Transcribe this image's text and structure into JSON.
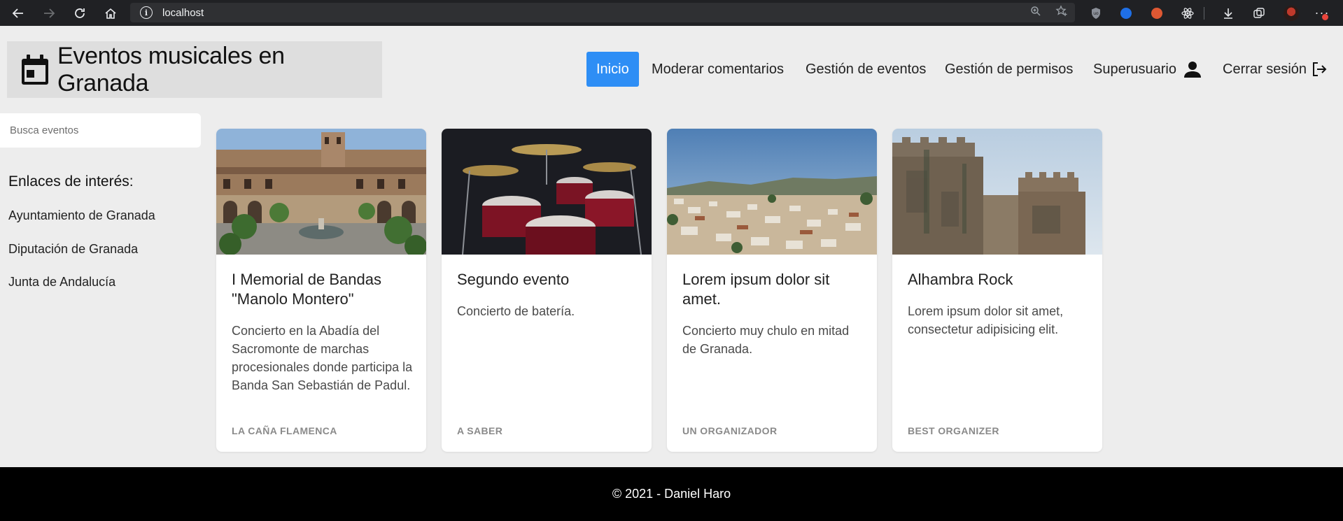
{
  "browser": {
    "url": "localhost"
  },
  "header": {
    "title": "Eventos musicales en Granada",
    "nav": [
      {
        "label": "Inicio"
      },
      {
        "label": "Moderar comentarios"
      },
      {
        "label": "Gestión de eventos"
      },
      {
        "label": "Gestión de permisos"
      },
      {
        "label": "Superusuario"
      },
      {
        "label": "Cerrar sesión"
      }
    ],
    "accent_color": "#2e8ef5"
  },
  "sidebar": {
    "search_placeholder": "Busca eventos",
    "links_title": "Enlaces de interés:",
    "links": [
      {
        "label": "Ayuntamiento de Granada"
      },
      {
        "label": "Diputación de Granada"
      },
      {
        "label": "Junta de Andalucía"
      }
    ]
  },
  "events": [
    {
      "title": "I Memorial de Bandas \"Manolo Montero\"",
      "description": "Concierto en la Abadía del Sacromonte de marchas procesionales donde participa la Banda San Sebastián de Padul.",
      "organizer": "LA CAÑA FLAMENCA"
    },
    {
      "title": "Segundo evento",
      "description": "Concierto de batería.",
      "organizer": "A SABER"
    },
    {
      "title": "Lorem ipsum dolor sit amet.",
      "description": "Concierto muy chulo en mitad de Granada.",
      "organizer": "UN ORGANIZADOR"
    },
    {
      "title": "Alhambra Rock",
      "description": "Lorem ipsum dolor sit amet, consectetur adipisicing elit.",
      "organizer": "BEST ORGANIZER"
    }
  ],
  "footer": {
    "text": "© 2021 - Daniel Haro"
  }
}
